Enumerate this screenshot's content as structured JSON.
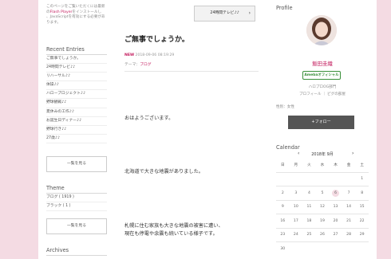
{
  "left": {
    "plugin_note_1": "このページをご覧いただくには最新",
    "plugin_note_2_pre": "の",
    "plugin_note_2_link": "Flash Player",
    "plugin_note_2_post": "をインストールし",
    "plugin_note_3": "、JavaScriptを有効にする必要があ",
    "plugin_note_4": "ります。",
    "recent_title": "Recent Entries",
    "recent_entries": [
      "ご無事でしょうか。",
      "24時間テレビ♪♪",
      "リハーサル♪♪",
      "体操♪♪",
      "ハロープロジェクト♪♪",
      "野球観戦♪♪",
      "夏休みの工作♪♪",
      "お誕生日ディナー♪♪",
      "野球行き♪♪",
      "27歳♪♪"
    ],
    "recent_more": "一覧を見る",
    "theme_title": "Theme",
    "themes": [
      "ブログ ( 1919 )",
      "ブラック ( 1 )"
    ],
    "theme_more": "一覧を見る",
    "archives_title": "Archives"
  },
  "main": {
    "next_button": "24時間テレビ♪♪",
    "title": "ご無事でしょうか。",
    "new_label": "NEW",
    "date": "2018-09-06 08:19:29",
    "theme_label": "テーマ：",
    "theme_value": "ブログ",
    "paragraphs": [
      "おはようございます。",
      "北海道で大きな地震がありました。",
      "札幌に住む家族も大きな地震の被害に遭い、",
      "現在も停電や余震も続いている様子です。"
    ]
  },
  "profile": {
    "title": "Profile",
    "name": "飯田圭織",
    "badge": "Amebaオフィシャル",
    "group": "ハロプロOG部門",
    "links": "プロフィール ｜ ピグの部屋",
    "gender": "性別：女性",
    "follow": "+フォロー"
  },
  "calendar": {
    "title": "Calendar",
    "month_label": "2018年 9月",
    "weekdays": [
      "日",
      "月",
      "火",
      "水",
      "木",
      "金",
      "土"
    ],
    "weeks": [
      [
        "",
        "",
        "",
        "",
        "",
        "",
        "1"
      ],
      [
        "2",
        "3",
        "4",
        "5",
        "6",
        "7",
        "8"
      ],
      [
        "9",
        "10",
        "11",
        "12",
        "13",
        "14",
        "15"
      ],
      [
        "16",
        "17",
        "18",
        "19",
        "20",
        "21",
        "22"
      ],
      [
        "23",
        "24",
        "25",
        "26",
        "27",
        "28",
        "29"
      ],
      [
        "30",
        "",
        "",
        "",
        "",
        "",
        ""
      ]
    ],
    "today": "6"
  },
  "colors": {
    "accent": "#c2185b",
    "background": "#f4dbe3",
    "follow_button": "#555555"
  }
}
